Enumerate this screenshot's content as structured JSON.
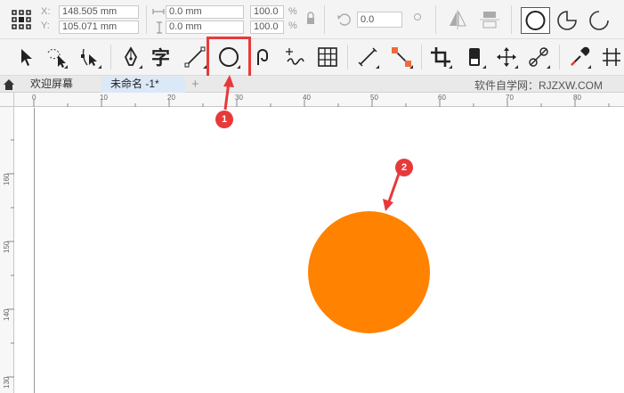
{
  "propbar": {
    "x_label": "X:",
    "y_label": "Y:",
    "x_value": "148.505 mm",
    "y_value": "105.071 mm",
    "w_value": "0.0 mm",
    "h_value": "0.0 mm",
    "scale_w": "100.0",
    "scale_h": "100.0",
    "percent": "%",
    "rotation": "0.0"
  },
  "tabs": {
    "welcome": "欢迎屏幕",
    "document": "未命名 -1*",
    "add": "+",
    "watermark": "软件自学网：RJZXW.COM"
  },
  "ruler": {
    "h_ticks": [
      "0",
      "10",
      "20",
      "30",
      "40",
      "50",
      "60",
      "70",
      "80"
    ],
    "v_ticks": [
      "160",
      "150",
      "140",
      "130"
    ]
  },
  "annotations": {
    "badge1": "1",
    "badge2": "2"
  },
  "colors": {
    "circle_fill": "#ff8200",
    "highlight": "#e8393a"
  },
  "icons": [
    "object-origin-icon",
    "pick-tool-icon",
    "freehand-pick-icon",
    "shape-tool-icon",
    "pen-tool-icon",
    "text-tool-icon",
    "line-tool-icon",
    "ellipse-tool-icon",
    "spiral-tool-icon",
    "artistic-media-icon",
    "table-tool-icon",
    "dimension-tool-icon",
    "connector-tool-icon",
    "crop-tool-icon",
    "eraser-tool-icon",
    "pan-tool-icon",
    "blend-tool-icon",
    "eyedropper-tool-icon",
    "more-tools-icon"
  ]
}
